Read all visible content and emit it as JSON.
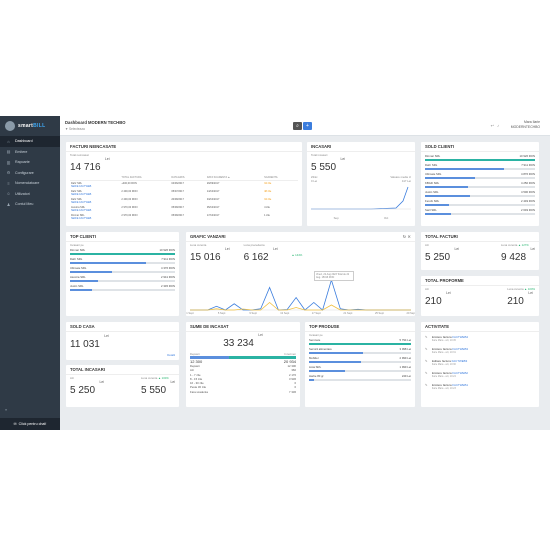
{
  "sidebar": {
    "logo_a": "smart",
    "logo_b": "BILL",
    "items": [
      {
        "label": "Dashboard",
        "icon": "home-icon",
        "glyph": "⌂",
        "active": true
      },
      {
        "label": "Emitere",
        "icon": "document-icon",
        "glyph": "▤"
      },
      {
        "label": "Rapoarte",
        "icon": "chart-icon",
        "glyph": "▥"
      },
      {
        "label": "Configurare",
        "icon": "gear-icon",
        "glyph": "⚙"
      },
      {
        "label": "Nomenclatoare",
        "icon": "list-icon",
        "glyph": "≡"
      },
      {
        "label": "Utilizatori",
        "icon": "user-icon",
        "glyph": "☺"
      },
      {
        "label": "Contul Meu",
        "icon": "account-icon",
        "glyph": "♟"
      }
    ],
    "chat_label": "Click pentru chat!",
    "collapse": "«"
  },
  "topbar": {
    "title": "Dashboard MODERN TECHBO",
    "subtitle": "▼ Selecteaza",
    "user_name": "Mara Ilarie",
    "user_company": "MODERNTECHBO",
    "accent": "#3b7ddd"
  },
  "facturi": {
    "title": "FACTURI NEINCASATE",
    "label": "Total neincasat",
    "value": "14 716",
    "currency": "Lei",
    "columns": [
      "",
      "TOTAL FACTURA",
      "DATA EMIS.",
      "DATA SCADENTA ▲",
      "SCADENTA"
    ],
    "rows": [
      [
        "Dahr SRL",
        "SERIE FACTWEB",
        "+400,00 RON",
        "04/06/2017",
        "29/09/2017",
        "34 zile"
      ],
      [
        "Dahr SRL",
        "SERIE FACTWEB",
        "2 400,00 RON",
        "05/07/2017",
        "14/10/2017",
        "48 zile"
      ],
      [
        "Dahr SRL",
        "SERIE FACTWEB",
        "2 400,00 RON",
        "20/08/2017",
        "04/10/2017",
        "34 zile"
      ],
      [
        "Ascotra SRL",
        "SERIE FACTWEB",
        "2 970,00 RON",
        "05/08/2017",
        "05/10/2017",
        "4 zile"
      ],
      [
        "Dinmar SRL",
        "SERIE FACTWEB",
        "2 970,00 RON",
        "05/08/2017",
        "17/10/2017",
        "1 zile"
      ]
    ]
  },
  "incasari": {
    "title": "INCASARI",
    "label": "Total incasari",
    "value": "5 550",
    "currency": "Lei",
    "sub1": "Zilnic",
    "sub1v": "0 Lei",
    "sub2": "Valoare medie zi",
    "sub2v": "417 Lei",
    "xlabels": [
      "Sep",
      "Oct"
    ]
  },
  "sold_clienti": {
    "title": "SOLD CLIENTI",
    "items": [
      {
        "name": "Dinmar SRL",
        "value": "10 926 RON",
        "pct": 100,
        "color": "#2bb3a3"
      },
      {
        "name": "Dahr SRL",
        "value": "7 911 RON",
        "pct": 72,
        "color": "#5b8fdd"
      },
      {
        "name": "Ultimate SRL",
        "value": "4 876 RON",
        "pct": 45,
        "color": "#5b8fdd"
      },
      {
        "name": "KBGD SRL",
        "value": "4 250 RON",
        "pct": 39,
        "color": "#5b8fdd"
      },
      {
        "name": "Justin SRL",
        "value": "4 500 RON",
        "pct": 41,
        "color": "#5b8fdd"
      },
      {
        "name": "Ferobi SRL",
        "value": "2 449 RON",
        "pct": 22,
        "color": "#5b8fdd"
      },
      {
        "name": "Saril SRL",
        "value": "2 649 RON",
        "pct": 24,
        "color": "#5b8fdd"
      }
    ]
  },
  "top_clienti": {
    "title": "TOP CLIENTI",
    "label": "Incasari pe",
    "items": [
      {
        "name": "Dinmar SRL",
        "value": "10 926 RON",
        "pct": 100,
        "color": "#2bb3a3"
      },
      {
        "name": "Dahr SRL",
        "value": "7 911 RON",
        "pct": 72,
        "color": "#5b8fdd"
      },
      {
        "name": "Ultimate SRL",
        "value": "4 376 RON",
        "pct": 40,
        "color": "#5b8fdd"
      },
      {
        "name": "Ascotra SRL",
        "value": "2 941 RON",
        "pct": 27,
        "color": "#5b8fdd"
      },
      {
        "name": "Justin SRL",
        "value": "2 345 RON",
        "pct": 21,
        "color": "#5b8fdd"
      }
    ]
  },
  "grafic": {
    "title": "GRAFIC VANZARI",
    "l1": "Luna curenta",
    "v1": "15 016",
    "c1": "Lei",
    "l2": "Luna precedenta",
    "v2": "6 162",
    "c2": "Lei",
    "change": "▲ 144%",
    "tooltip": "Vineri, 22 Aug 2023 Total de 22 Aug. 15016 RON"
  },
  "chart_data": {
    "type": "line",
    "series": [
      {
        "values": [
          0,
          0,
          0,
          1500,
          0,
          2500,
          0,
          0,
          500,
          9000,
          0,
          200,
          5000,
          0,
          3000,
          0,
          12000,
          500,
          0,
          300,
          0,
          0,
          0,
          0,
          0,
          0
        ]
      },
      {
        "values": [
          0,
          0,
          0,
          500,
          0,
          0,
          400,
          0,
          0,
          3000,
          0,
          0,
          1000,
          0,
          0,
          0,
          2000,
          0,
          0,
          0,
          0,
          0,
          0,
          0,
          0,
          0
        ]
      }
    ],
    "x_ticks": [
      "1 Sept",
      "5 Sept",
      "9 Sept",
      "13 Sept",
      "17 Sept",
      "21 Sept",
      "25 Sept",
      "29 Sept"
    ],
    "ylim": [
      0,
      16000
    ],
    "colors": [
      "#3b7ddd",
      "#f0c040"
    ]
  },
  "total_facturi": {
    "title": "TOTAL FACTURI",
    "l1": "Azi",
    "v1": "5 250",
    "c1": "Lei",
    "l2": "Luna curenta",
    "change": "▲ 127%",
    "v2": "9 428",
    "c2": "Lei"
  },
  "total_proforme": {
    "title": "TOTAL PROFORME",
    "l1": "Azi",
    "v1": "210",
    "c1": "Lei",
    "l2": "Luna curenta",
    "change": "▲ 100%",
    "v2": "210",
    "c2": "Lei"
  },
  "sold_casa": {
    "title": "SOLD CASA",
    "value": "11 031",
    "currency": "Lei",
    "link": "Detalii"
  },
  "sume": {
    "title": "SUME DE INCASAT",
    "value": "33 234",
    "currency": "Lei",
    "l1": "Depasit",
    "v1": "12 300",
    "l2": "In termen",
    "v2": "20 934",
    "pct": 37,
    "rows": [
      [
        "Depasit",
        "12 300"
      ],
      [
        "Azi",
        "360"
      ],
      [
        "1 - 7 zile",
        "2 170"
      ],
      [
        "8 - 15 zile",
        "3 936"
      ],
      [
        "16 - 30 zile",
        "0"
      ],
      [
        "Peste 30 zile",
        "0"
      ],
      [
        "Fara scadenta",
        "7 336"
      ]
    ]
  },
  "top_produse": {
    "title": "TOP PRODUSE",
    "label": "Incasari pe",
    "items": [
      {
        "name": "Semnare",
        "value": "5 794 Lei",
        "pct": 100,
        "color": "#2bb3a3"
      },
      {
        "name": "Servicii alimentare",
        "value": "3 098 Lei",
        "pct": 53,
        "color": "#5b8fdd"
      },
      {
        "name": "Mobilier",
        "value": "2 999 Lei",
        "pct": 51,
        "color": "#5b8fdd"
      },
      {
        "name": "Lista SRL",
        "value": "1 999 Lei",
        "pct": 35,
        "color": "#5b8fdd"
      },
      {
        "name": "Hartie 80 gr",
        "value": "249 Lei",
        "pct": 5,
        "color": "#5b8fdd"
      }
    ]
  },
  "activitate": {
    "title": "ACTIVITATE",
    "items": [
      {
        "text": "Emitere factura",
        "link": "FACTWEB4",
        "date": "Ilarie Mara - azi, 10:45"
      },
      {
        "text": "Emitere factura",
        "link": "FACTWEB3",
        "date": "Ilarie Mara - azi, 10:31"
      },
      {
        "text": "Editare factura",
        "link": "FACTWEB3",
        "date": "Ilarie Mara - azi, 10:30"
      },
      {
        "text": "Emitere factura",
        "link": "FACTWEB2",
        "date": "Ilarie Mara - azi, 10:24"
      },
      {
        "text": "Emitere factura",
        "link": "FACTWEB1",
        "date": "Ilarie Mara - azi, 10:23"
      }
    ]
  },
  "total_incasari": {
    "title": "TOTAL INCASARI",
    "l1": "Azi",
    "v1": "5 250",
    "c1": "Lei",
    "l2": "Luna curenta",
    "change": "▲ 100%",
    "v2": "5 550",
    "c2": "Lei"
  }
}
